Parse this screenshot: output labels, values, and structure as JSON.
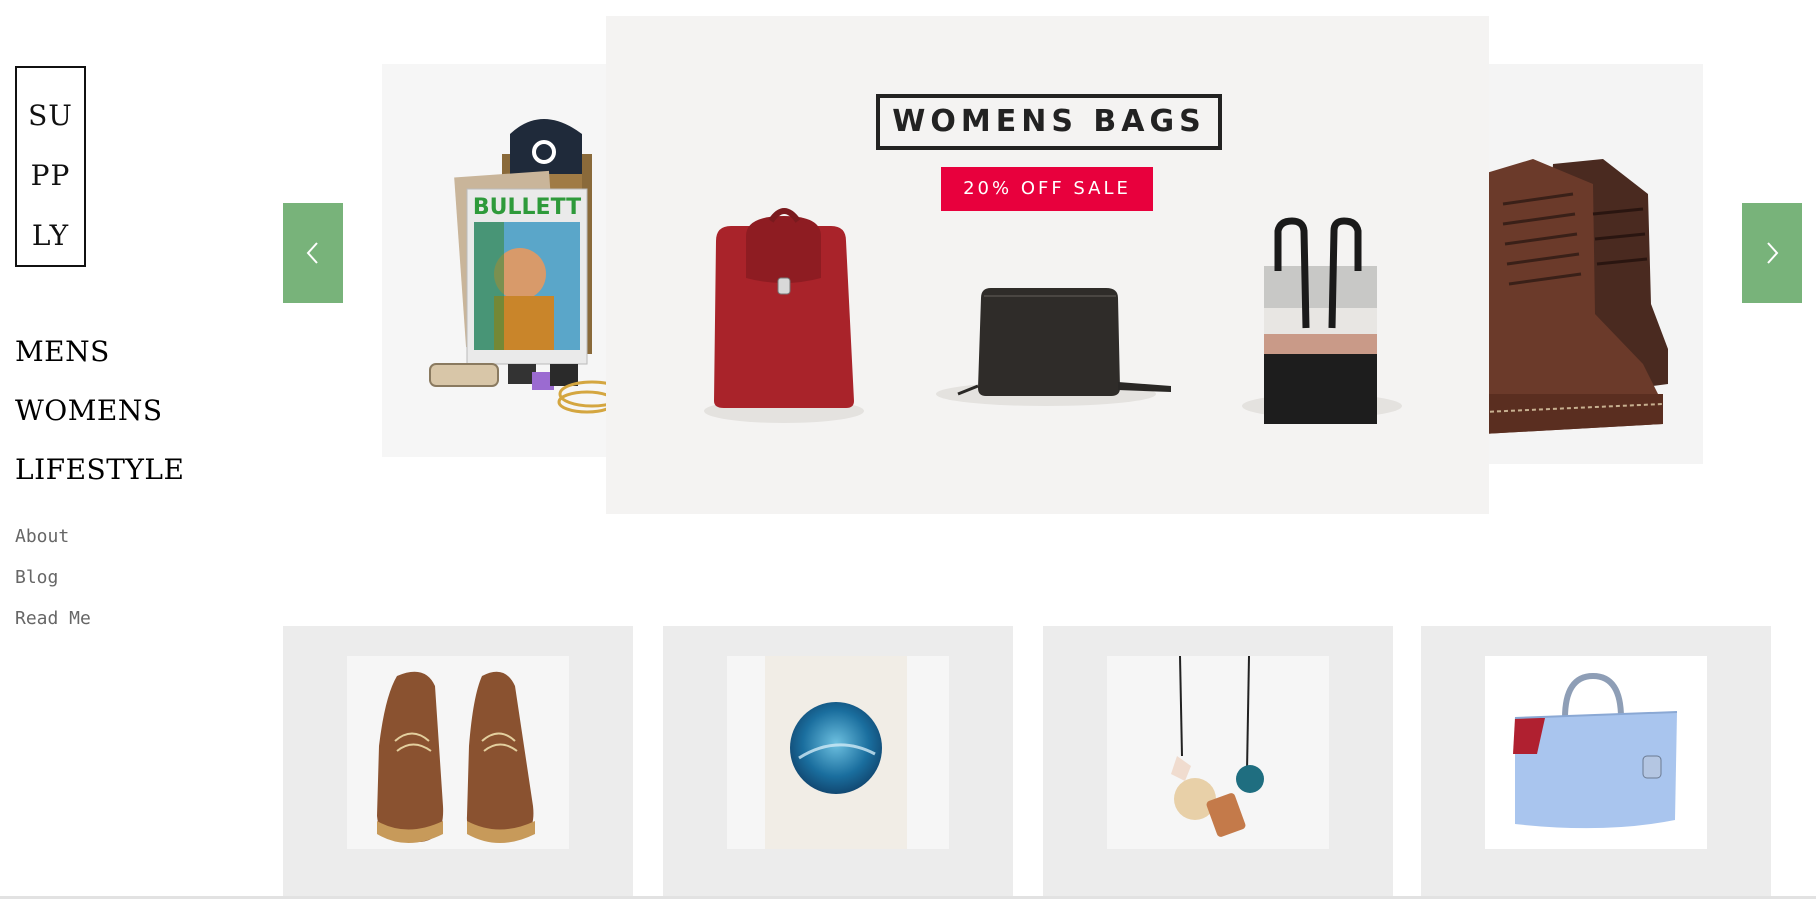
{
  "brand": {
    "logo_lines": [
      "SU",
      "PP",
      "LY"
    ]
  },
  "main_nav": [
    {
      "label": "MENS"
    },
    {
      "label": "WOMENS"
    },
    {
      "label": "LIFESTYLE"
    }
  ],
  "secondary_nav": [
    {
      "label": "About"
    },
    {
      "label": "Blog"
    },
    {
      "label": "Read Me"
    }
  ],
  "carousel": {
    "main_slide": {
      "title": "WOMENS BAGS",
      "badge": "20% OFF SALE"
    },
    "left_slide": {
      "magazine_title": "BULLETT"
    },
    "prev_icon": "chevron-left-icon",
    "next_icon": "chevron-right-icon",
    "arrow_color": "#78b37a",
    "badge_color": "#e8003d"
  },
  "products": [
    {
      "icon": "brown-boots-product-image"
    },
    {
      "icon": "ocean-circle-print-product-image"
    },
    {
      "icon": "wooden-bead-necklace-product-image"
    },
    {
      "icon": "blue-handbag-product-image"
    }
  ]
}
